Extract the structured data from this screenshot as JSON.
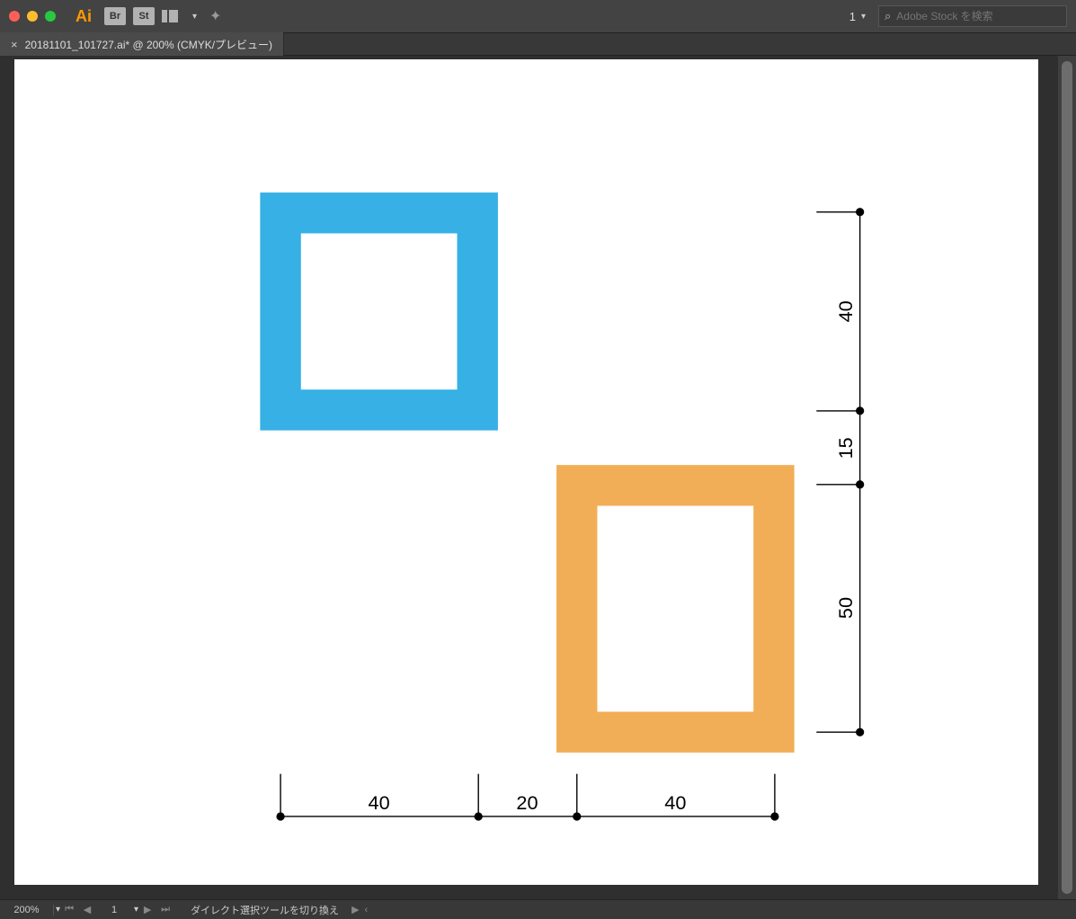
{
  "titlebar": {
    "br_label": "Br",
    "st_label": "St",
    "workspace": "1",
    "search_placeholder": "Adobe Stock を検索"
  },
  "tab": {
    "title": "20181101_101727.ai* @ 200% (CMYK/プレビュー)"
  },
  "artwork": {
    "shape_blue_color": "#36B0E5",
    "shape_orange_color": "#F2AE56",
    "dim_h1": "40",
    "dim_h2": "20",
    "dim_h3": "40",
    "dim_v1": "40",
    "dim_v2": "15",
    "dim_v3": "50"
  },
  "status": {
    "zoom": "200%",
    "page": "1",
    "message": "ダイレクト選択ツールを切り換え"
  }
}
